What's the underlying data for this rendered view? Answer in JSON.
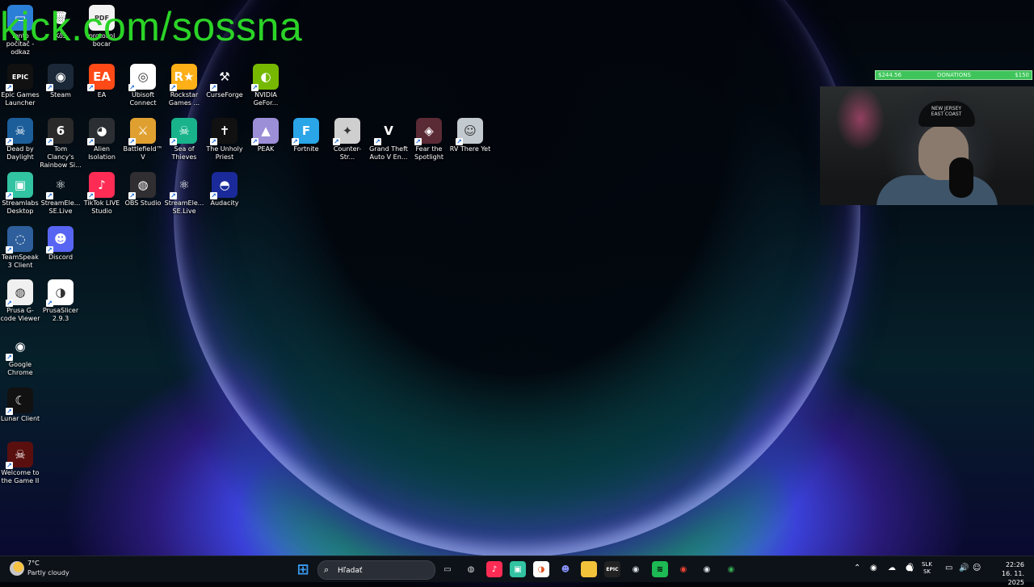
{
  "overlay": {
    "url": "kick.com/sossna",
    "donation_left": "$244.56",
    "donation_label": "DONATIONS",
    "donation_right": "$150",
    "cap_text": "NEW JERSEY EAST COAST"
  },
  "desktop_icons": [
    {
      "label": "Tento počítač - odkaz",
      "icon": "this-pc-icon",
      "bg": "#2c7fd6",
      "glyph": "▭"
    },
    {
      "label": "Kôš",
      "icon": "recycle-bin-icon",
      "bg": "transparent",
      "glyph": "🗑"
    },
    {
      "label": "protokol bocar",
      "icon": "pdf-file-icon",
      "bg": "#f2f2f2",
      "glyph": "PDF"
    },
    {
      "label": "Epic Games Launcher",
      "icon": "epic-games-icon",
      "bg": "#111111",
      "glyph": "EPIC"
    },
    {
      "label": "Steam",
      "icon": "steam-icon",
      "bg": "#1b2838",
      "glyph": "◉"
    },
    {
      "label": "EA",
      "icon": "ea-icon",
      "bg": "#ff4a17",
      "glyph": "EA"
    },
    {
      "label": "Ubisoft Connect",
      "icon": "ubisoft-icon",
      "bg": "#ffffff",
      "glyph": "◎"
    },
    {
      "label": "Rockstar Games ...",
      "icon": "rockstar-icon",
      "bg": "#fcaf17",
      "glyph": "R★"
    },
    {
      "label": "CurseForge",
      "icon": "curseforge-icon",
      "bg": "transparent",
      "glyph": "⚒"
    },
    {
      "label": "NVIDIA GeFor...",
      "icon": "nvidia-icon",
      "bg": "#76b900",
      "glyph": "◐"
    },
    {
      "label": "Dead by Daylight",
      "icon": "dead-by-daylight-icon",
      "bg": "#1c5e9a",
      "glyph": "☠"
    },
    {
      "label": "Tom Clancy's Rainbow Si...",
      "icon": "rainbow-six-icon",
      "bg": "#2a2a2a",
      "glyph": "6"
    },
    {
      "label": "Alien Isolation",
      "icon": "alien-isolation-icon",
      "bg": "#2b2f33",
      "glyph": "◕"
    },
    {
      "label": "Battlefield™ V",
      "icon": "battlefield-icon",
      "bg": "#e0a030",
      "glyph": "⚔"
    },
    {
      "label": "Sea of Thieves",
      "icon": "sea-of-thieves-icon",
      "bg": "#18b38a",
      "glyph": "☠"
    },
    {
      "label": "The Unholy Priest",
      "icon": "unholy-priest-icon",
      "bg": "#111111",
      "glyph": "✝"
    },
    {
      "label": "PEAK",
      "icon": "peak-icon",
      "bg": "#9c8fd8",
      "glyph": "▲"
    },
    {
      "label": "Fortnite",
      "icon": "fortnite-icon",
      "bg": "#29a5e8",
      "glyph": "F"
    },
    {
      "label": "Counter-Str...",
      "icon": "counter-strike-icon",
      "bg": "#cfcfcf",
      "glyph": "✦"
    },
    {
      "label": "Grand Theft Auto V En...",
      "icon": "gta-v-icon",
      "bg": "transparent",
      "glyph": "V"
    },
    {
      "label": "Fear the Spotlight",
      "icon": "fear-the-spotlight-icon",
      "bg": "#5a2a35",
      "glyph": "◈"
    },
    {
      "label": "RV There Yet",
      "icon": "rv-there-yet-icon",
      "bg": "#c2c9cf",
      "glyph": "☺"
    },
    {
      "label": "Streamlabs Desktop",
      "icon": "streamlabs-icon",
      "bg": "#31c3a2",
      "glyph": "▣"
    },
    {
      "label": "StreamEle... SE.Live",
      "icon": "streamelements-icon",
      "bg": "transparent",
      "glyph": "⚛"
    },
    {
      "label": "TikTok LIVE Studio",
      "icon": "tiktok-live-studio-icon",
      "bg": "#fe2c55",
      "glyph": "♪"
    },
    {
      "label": "OBS Studio",
      "icon": "obs-studio-icon",
      "bg": "#302e31",
      "glyph": "◍"
    },
    {
      "label": "StreamEle... SE.Live",
      "icon": "streamelements-icon",
      "bg": "transparent",
      "glyph": "⚛"
    },
    {
      "label": "Audacity",
      "icon": "audacity-icon",
      "bg": "#1a2a9a",
      "glyph": "◓"
    },
    {
      "label": "TeamSpeak 3 Client",
      "icon": "teamspeak-icon",
      "bg": "#2e5f9c",
      "glyph": "◌"
    },
    {
      "label": "Discord",
      "icon": "discord-icon",
      "bg": "#5865f2",
      "glyph": "☻"
    },
    {
      "label": "Prusa G-code Viewer",
      "icon": "prusa-gcode-viewer-icon",
      "bg": "#f0f0f0",
      "glyph": "◍"
    },
    {
      "label": "PrusaSlicer 2.9.3",
      "icon": "prusaslicer-icon",
      "bg": "#ffffff",
      "glyph": "◑"
    },
    {
      "label": "Google Chrome",
      "icon": "chrome-icon",
      "bg": "transparent",
      "glyph": "◉"
    },
    {
      "label": "Lunar Client",
      "icon": "lunar-client-icon",
      "bg": "#111111",
      "glyph": "☾"
    },
    {
      "label": "Welcome to the Game II",
      "icon": "welcome-to-the-game-icon",
      "bg": "#5a0f0f",
      "glyph": "☠"
    }
  ],
  "taskbar": {
    "weather_temp": "7°C",
    "weather_desc": "Partly cloudy",
    "search_placeholder": "Hľadať",
    "lang_top": "SLK",
    "lang_bottom": "SK",
    "time": "22:26",
    "date": "16. 11. 2025",
    "apps": [
      {
        "name": "start-button",
        "glyph": "⊞",
        "bg": "transparent",
        "color": "#3a9bf2"
      },
      {
        "name": "task-view-button",
        "glyph": "▭",
        "bg": "transparent",
        "color": "#ddd"
      },
      {
        "name": "taskbar-obs-studio",
        "glyph": "◍",
        "bg": "transparent",
        "color": "#ddd"
      },
      {
        "name": "taskbar-tiktok-live-studio",
        "glyph": "♪",
        "bg": "#fe2c55",
        "color": "#fff"
      },
      {
        "name": "taskbar-streamlabs",
        "glyph": "▣",
        "bg": "#31c3a2",
        "color": "#fff"
      },
      {
        "name": "taskbar-prusaslicer",
        "glyph": "◑",
        "bg": "#ffffff",
        "color": "#e0501f"
      },
      {
        "name": "taskbar-discord",
        "glyph": "☻",
        "bg": "transparent",
        "color": "#8c95ff"
      },
      {
        "name": "taskbar-file-explorer",
        "glyph": "▬",
        "bg": "#f3c23b",
        "color": "#f3c23b"
      },
      {
        "name": "taskbar-epic-games",
        "glyph": "EPIC",
        "bg": "#222",
        "color": "#fff"
      },
      {
        "name": "taskbar-steam",
        "glyph": "◉",
        "bg": "transparent",
        "color": "#dfe6ee"
      },
      {
        "name": "taskbar-spotify",
        "glyph": "≋",
        "bg": "#1db954",
        "color": "#000"
      },
      {
        "name": "taskbar-chrome",
        "glyph": "◉",
        "bg": "transparent",
        "color": "#ea4335"
      },
      {
        "name": "taskbar-steam-2",
        "glyph": "◉",
        "bg": "transparent",
        "color": "#dfe6ee"
      },
      {
        "name": "taskbar-chrome-2",
        "glyph": "◉",
        "bg": "transparent",
        "color": "#34a853"
      }
    ],
    "tray_icons": [
      {
        "name": "show-hidden-icons-chevron-icon",
        "glyph": "⌃"
      },
      {
        "name": "steam-tray-icon",
        "glyph": "◉"
      },
      {
        "name": "onedrive-tray-icon",
        "glyph": "☁"
      },
      {
        "name": "record-tray-icon",
        "glyph": "●"
      },
      {
        "name": "microphone-icon",
        "glyph": "🎙"
      },
      {
        "name": "network-icon",
        "glyph": "▭"
      },
      {
        "name": "volume-icon",
        "glyph": "🔊"
      },
      {
        "name": "notifications-icon",
        "glyph": "☺"
      }
    ]
  }
}
